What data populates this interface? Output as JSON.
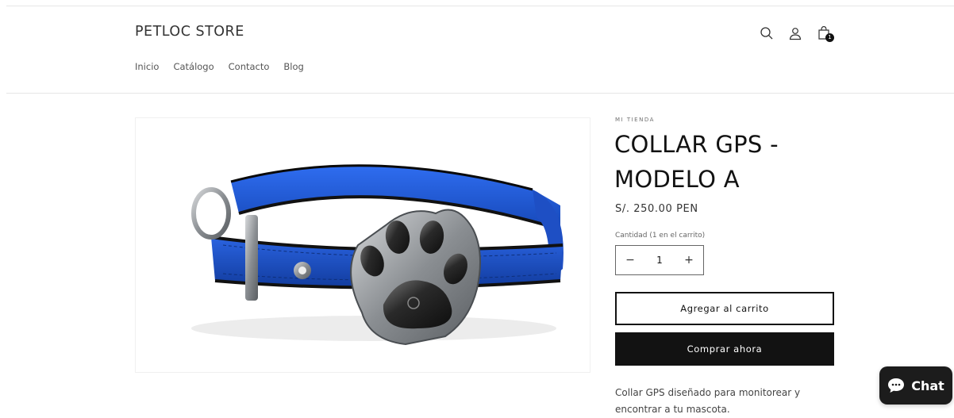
{
  "store": {
    "name": "PETLOC STORE"
  },
  "nav": {
    "items": [
      "Inicio",
      "Catálogo",
      "Contacto",
      "Blog"
    ]
  },
  "header_icons": {
    "search": "search-icon",
    "account": "user-icon",
    "cart": "cart-icon",
    "cart_count": "1"
  },
  "product": {
    "vendor": "MI TIENDA",
    "title": "COLLAR GPS - MODELO A",
    "price": "S/. 250.00 PEN",
    "quantity_label": "Cantidad (1 en el carrito)",
    "quantity_minus": "−",
    "quantity_value": "1",
    "quantity_plus": "+",
    "add_to_cart": "Agregar al carrito",
    "buy_now": "Comprar ahora",
    "description": "Collar GPS diseñado para monitorear y encontrar a tu mascota."
  },
  "chat": {
    "label": "Chat",
    "icon": "chat-bubble-icon"
  },
  "colors": {
    "collar_blue": "#1f5fd8",
    "button_dark": "#121212"
  }
}
